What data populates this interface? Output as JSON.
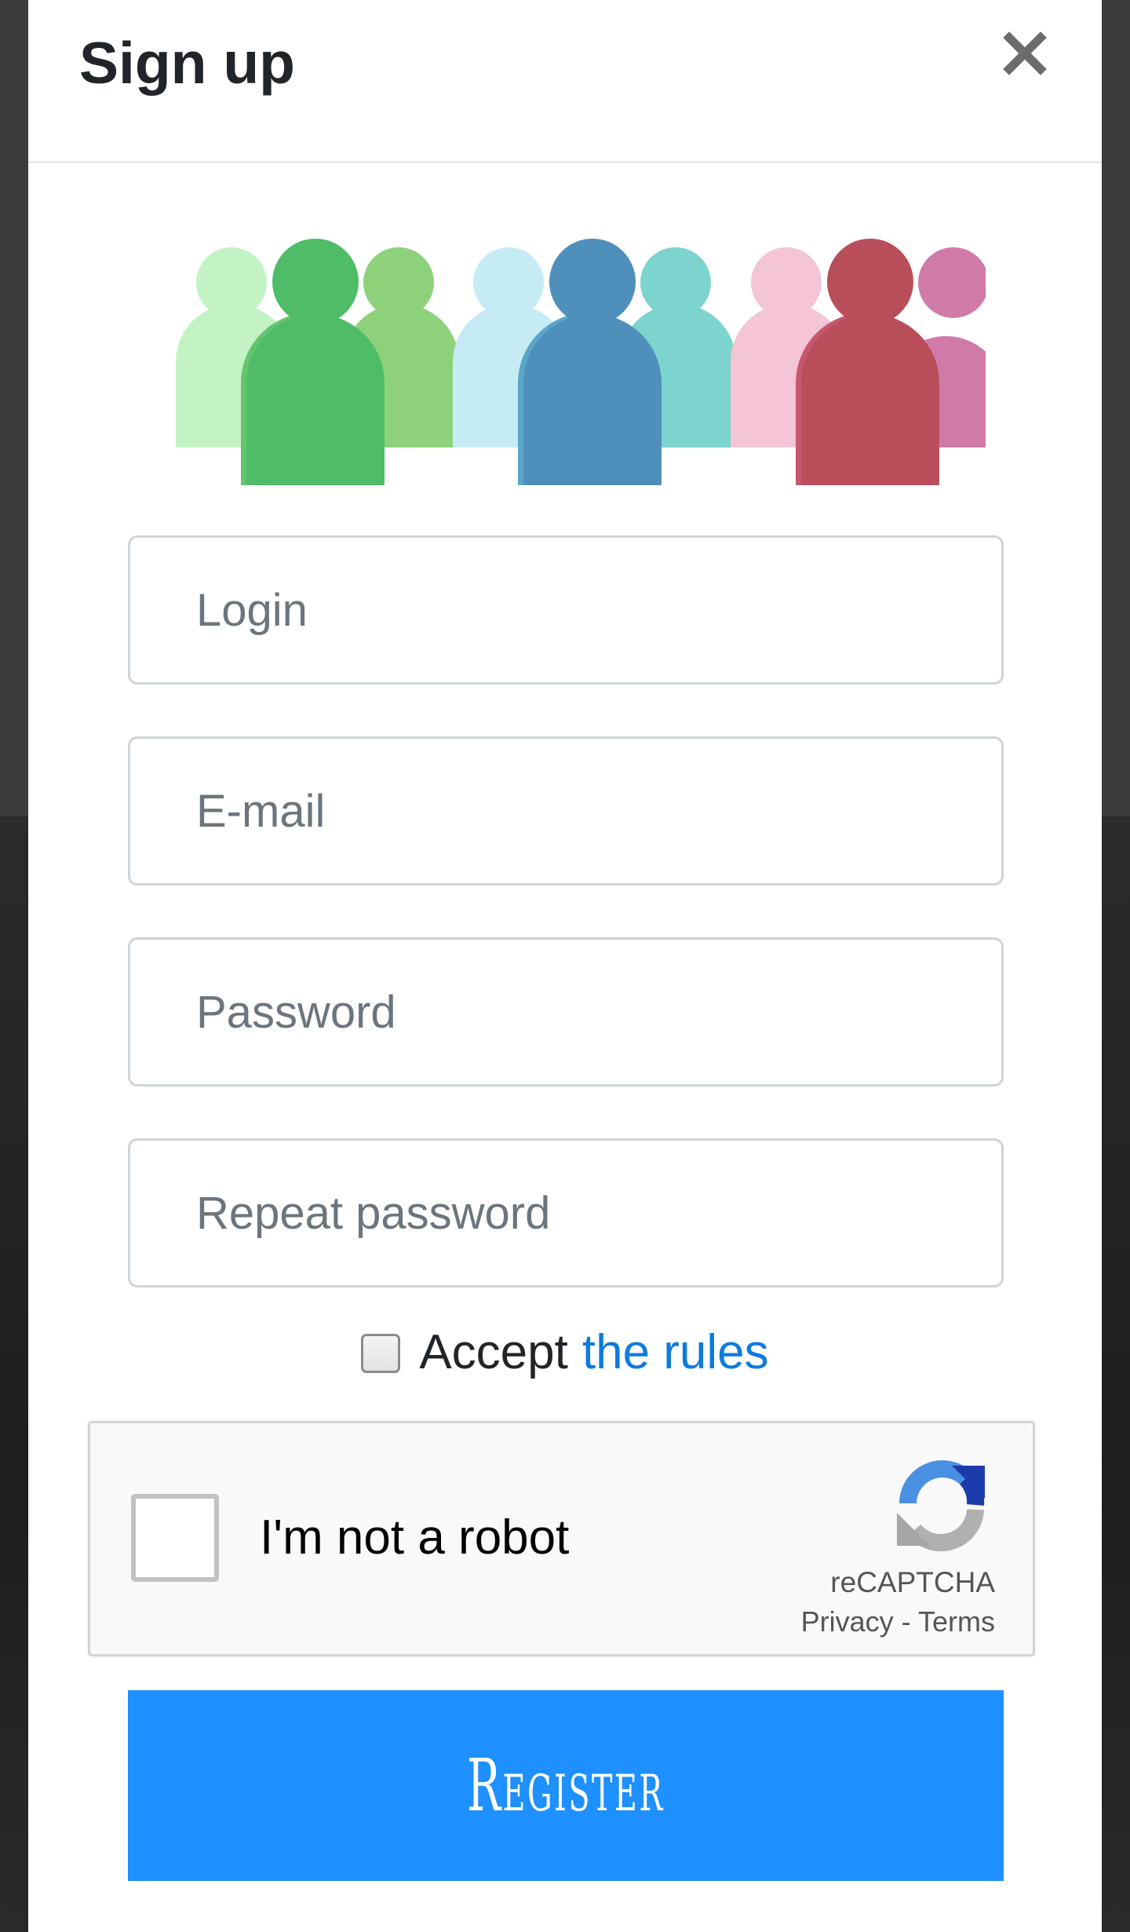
{
  "modal": {
    "title": "Sign up",
    "close_icon": "close-icon"
  },
  "illustration": {
    "icon": "people-group-icon",
    "groups": [
      {
        "colors": [
          "#c3f2c5",
          "#4fbd67",
          "#8dd27b"
        ]
      },
      {
        "colors": [
          "#c5ecf4",
          "#4f8fbb",
          "#7dd3cd"
        ]
      },
      {
        "colors": [
          "#f4c4d7",
          "#b94e5b",
          "#d07aa8"
        ]
      }
    ]
  },
  "form": {
    "login_placeholder": "Login",
    "email_placeholder": "E-mail",
    "password_placeholder": "Password",
    "repeat_password_placeholder": "Repeat password",
    "accept_text": "Accept",
    "rules_link": "the rules",
    "accept_checked": false
  },
  "recaptcha": {
    "label": "I'm not a robot",
    "brand": "reCAPTCHA",
    "privacy": "Privacy",
    "separator": " - ",
    "terms": "Terms",
    "checked": false,
    "icon": "recaptcha-logo-icon"
  },
  "register": {
    "label": "Register",
    "color": "#1e90ff"
  }
}
